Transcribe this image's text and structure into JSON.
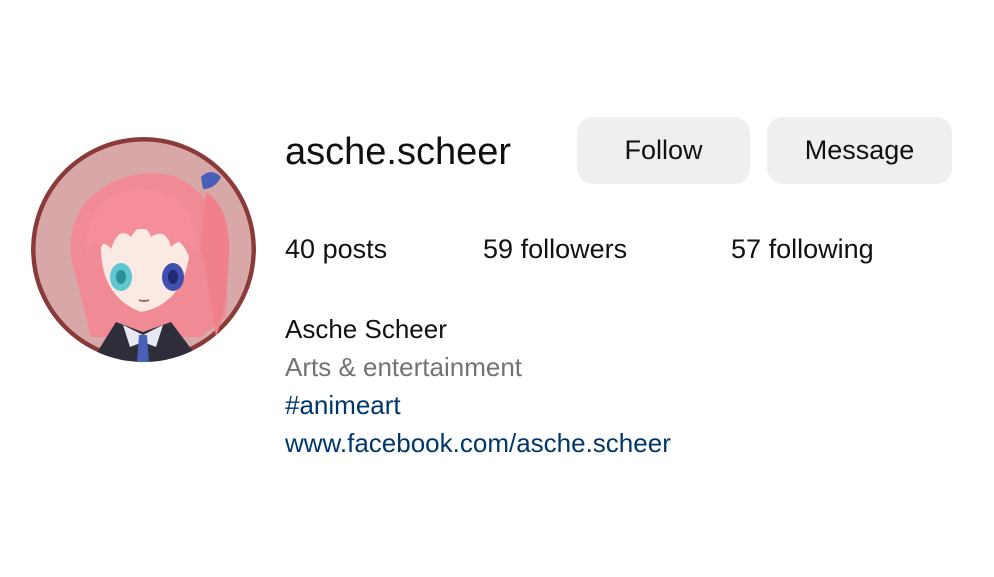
{
  "profile": {
    "username": "asche.scheer",
    "avatar_alt": "profile picture"
  },
  "actions": {
    "follow_label": "Follow",
    "message_label": "Message"
  },
  "stats": {
    "posts": "40",
    "posts_label": "posts",
    "followers": "59",
    "followers_label": "followers",
    "following": "57",
    "following_label": "following"
  },
  "bio": {
    "name": "Asche Scheer",
    "category": "Arts & entertainment",
    "hashtag": "#animeart",
    "link": "www.facebook.com/asche.scheer"
  },
  "colors": {
    "button_bg": "#efefef",
    "link": "#00376b",
    "secondary_text": "#737373",
    "avatar_ring": "#8b3a3a"
  }
}
